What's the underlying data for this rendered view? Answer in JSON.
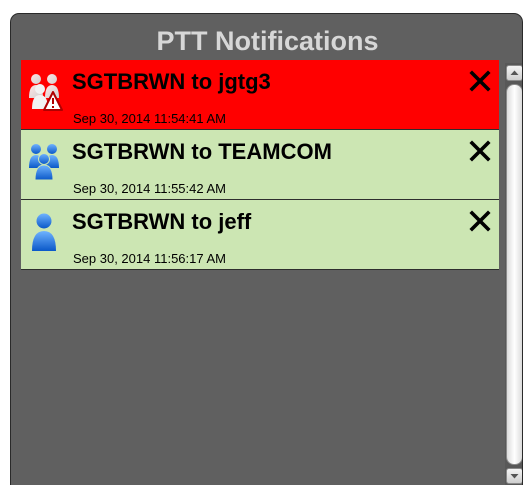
{
  "panel": {
    "title": "PTT Notifications"
  },
  "notifications": [
    {
      "name": "SGTBRWN to jgtg3",
      "time": "Sep 30, 2014 11:54:41 AM",
      "status": "alert",
      "color": "#ff0000",
      "icon": "group-warning-icon"
    },
    {
      "name": "SGTBRWN to TEAMCOM",
      "time": "Sep 30, 2014 11:55:42 AM",
      "status": "normal",
      "color": "#cce6b3",
      "icon": "group-icon"
    },
    {
      "name": "SGTBRWN to jeff",
      "time": "Sep 30, 2014 11:56:17 AM",
      "status": "normal",
      "color": "#cce6b3",
      "icon": "person-icon"
    }
  ]
}
